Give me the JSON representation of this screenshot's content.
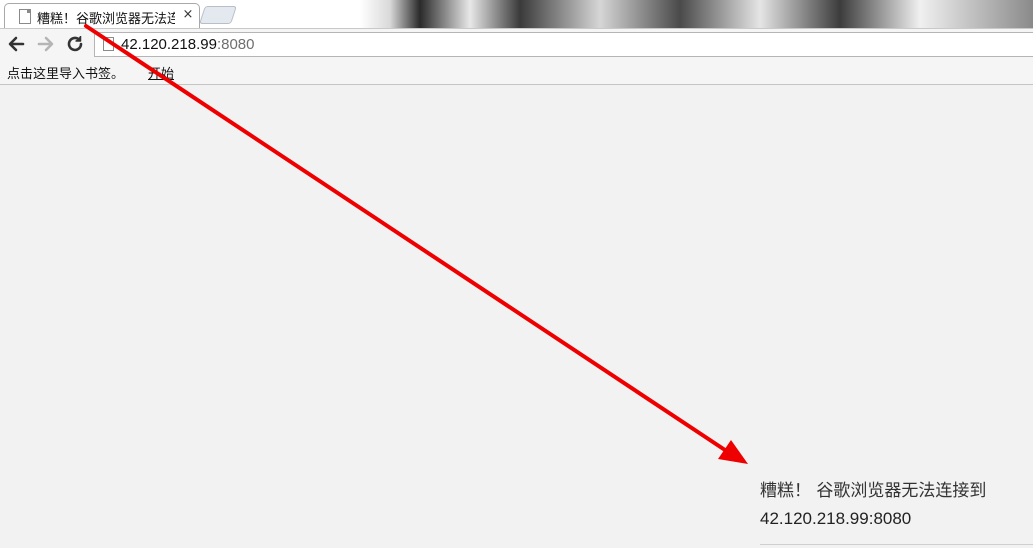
{
  "tab": {
    "title": "糟糕！谷歌浏览器无法连接到",
    "close": "×"
  },
  "toolbar": {
    "icons": [
      "back-arrow-icon",
      "forward-arrow-icon",
      "reload-icon",
      "page-icon"
    ],
    "url_host": "42.120.218.99",
    "url_port": ":8080"
  },
  "bookmarks": {
    "hint": "点击这里导入书签。",
    "start_link": "开始"
  },
  "error": {
    "title": "糟糕！ 谷歌浏览器无法连接到",
    "url": "42.120.218.99:8080"
  },
  "annotation": {
    "color": "#ee0000",
    "type": "arrow"
  }
}
